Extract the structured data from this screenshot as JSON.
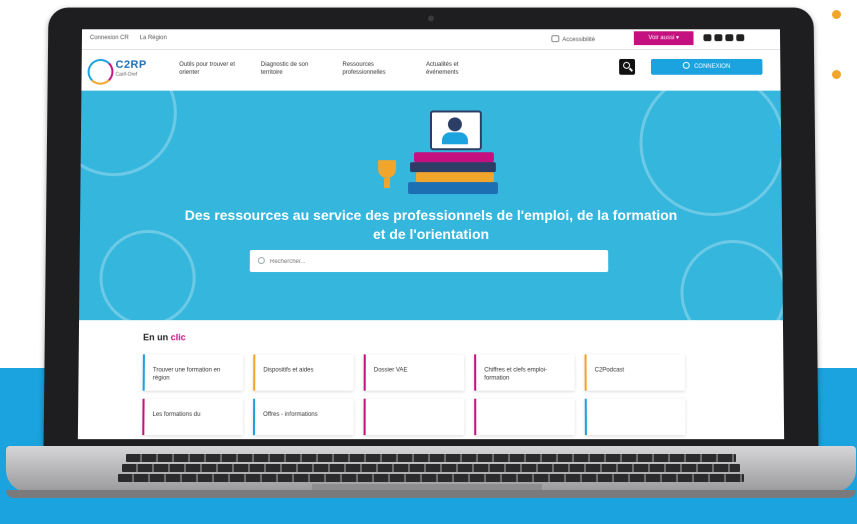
{
  "colors": {
    "accent_blue": "#1aa3df",
    "accent_magenta": "#c4117f",
    "accent_orange": "#f2a52b",
    "hero_bg": "#35b6dd"
  },
  "topbar": {
    "link1": "Connexion CR",
    "link2": "La Région",
    "accessibility": "Accessibilité",
    "see_all": "Voir aussi",
    "social_icons": [
      "youtube-icon",
      "email-icon",
      "linkedin-icon",
      "podcast-icon"
    ]
  },
  "logo": {
    "name": "C2RP",
    "sub": "Carif-Oref"
  },
  "nav": [
    {
      "label": "Outils pour trouver et orienter"
    },
    {
      "label": "Diagnostic de son territoire"
    },
    {
      "label": "Ressources professionnelles"
    },
    {
      "label": "Actualités et événements"
    }
  ],
  "header": {
    "connect_label": "CONNEXION"
  },
  "hero": {
    "title": "Des ressources au service des professionnels de l'emploi, de la formation et de l'orientation",
    "search_placeholder": "Rechercher..."
  },
  "clic": {
    "title_main": "En un ",
    "title_accent": "clic"
  },
  "cards": [
    {
      "label": "Trouver une formation en région",
      "color": "#1aa3df"
    },
    {
      "label": "Dispositifs et aides",
      "color": "#f2a52b"
    },
    {
      "label": "Dossier VAE",
      "color": "#c4117f"
    },
    {
      "label": "Chiffres et clefs emploi-formation",
      "color": "#c4117f"
    },
    {
      "label": "C2Podcast",
      "color": "#f2a52b"
    },
    {
      "label": "Les formations du",
      "color": "#c4117f"
    },
    {
      "label": "Offres - informations",
      "color": "#1aa3df"
    }
  ]
}
